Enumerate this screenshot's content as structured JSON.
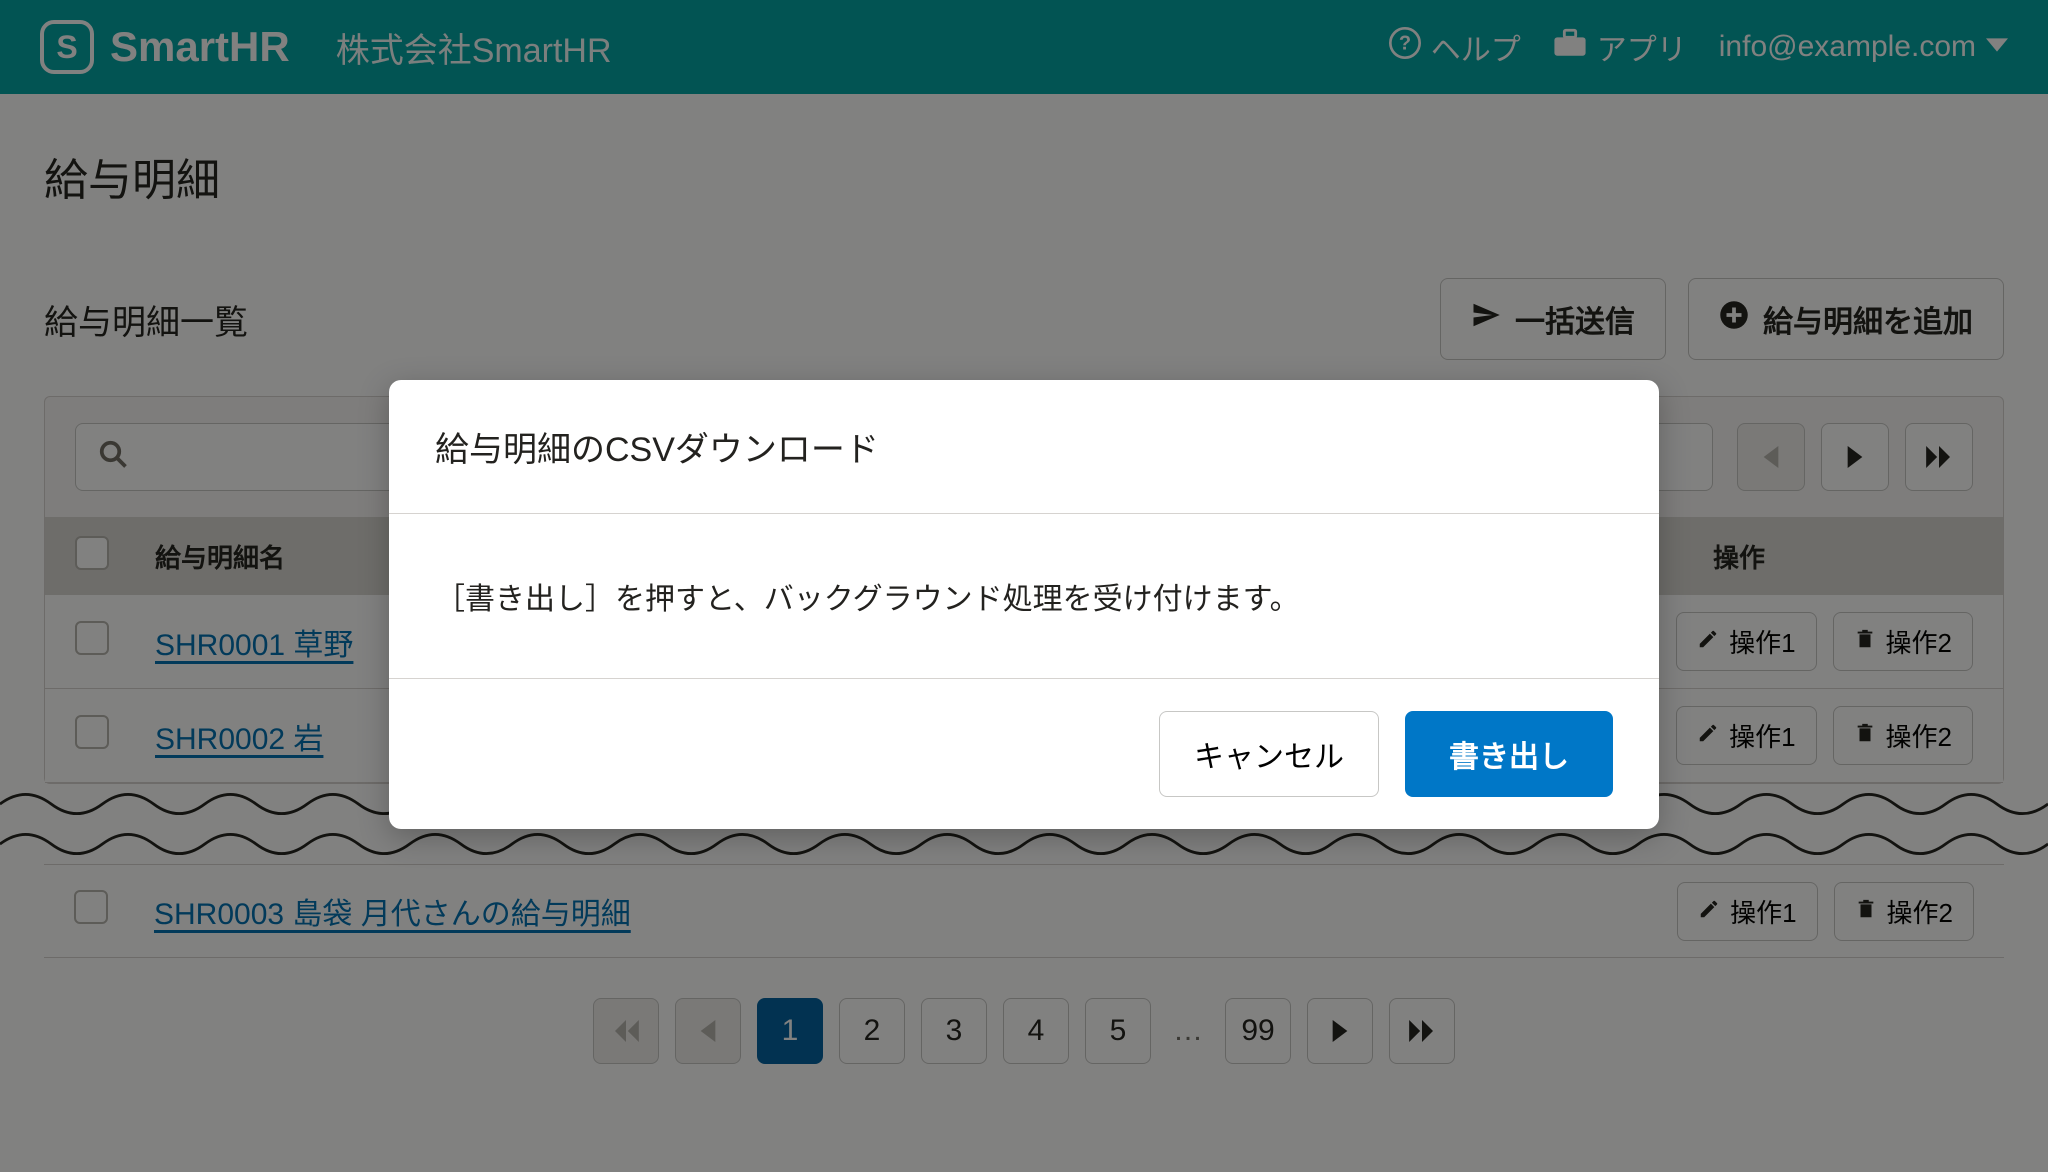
{
  "header": {
    "product": "SmartHR",
    "company": "株式会社SmartHR",
    "help": "ヘルプ",
    "apps": "アプリ",
    "account": "info@example.com"
  },
  "page": {
    "title": "給与明細",
    "list_title": "給与明細一覧",
    "bulk_send": "一括送信",
    "add_payslip": "給与明細を追加"
  },
  "table": {
    "col_name": "給与明細名",
    "col_ops": "操作",
    "rows": [
      {
        "name": "SHR0001 草野"
      },
      {
        "name": "SHR0002 岩"
      },
      {
        "name": "SHR0003 島袋 月代さんの給与明細"
      }
    ],
    "op1": "操作1",
    "op2": "操作2"
  },
  "pagination": {
    "pages": [
      "1",
      "2",
      "3",
      "4",
      "5"
    ],
    "last": "99",
    "ellipsis": "…"
  },
  "dialog": {
    "title": "給与明細のCSVダウンロード",
    "message": "［書き出し］を押すと、バックグラウンド処理を受け付けます。",
    "cancel": "キャンセル",
    "confirm": "書き出し"
  }
}
